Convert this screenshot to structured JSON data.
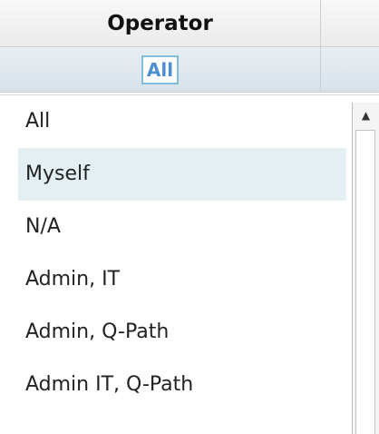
{
  "grid": {
    "header": {
      "operator_label": "Operator"
    },
    "filter": {
      "value": "All"
    }
  },
  "dropdown": {
    "items": [
      {
        "label": "All"
      },
      {
        "label": "Myself"
      },
      {
        "label": "N/A"
      },
      {
        "label": "Admin, IT"
      },
      {
        "label": "Admin, Q-Path"
      },
      {
        "label": "Admin IT, Q-Path"
      }
    ],
    "highlighted_index": 1,
    "scroll_up_glyph": "▲"
  },
  "colors": {
    "highlight_row": "#e3eff3",
    "filter_chip_text": "#4d8fd1",
    "filter_chip_border": "#7fbedf"
  }
}
